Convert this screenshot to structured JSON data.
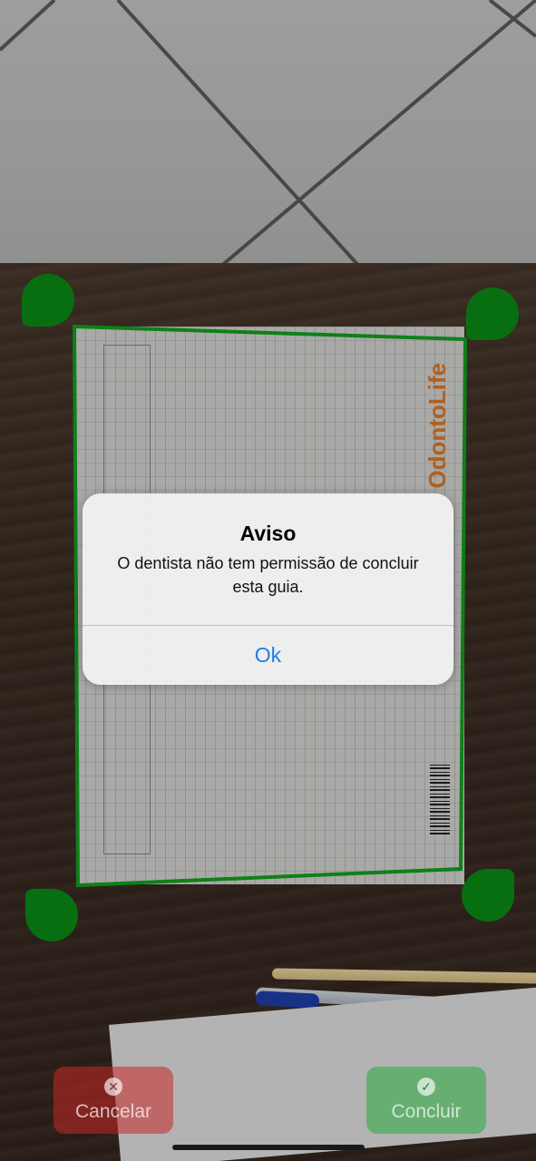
{
  "alert": {
    "title": "Aviso",
    "message": "O dentista não tem permissão de concluir esta guia.",
    "ok_label": "Ok"
  },
  "actions": {
    "cancel_label": "Cancelar",
    "cancel_icon": "close-circle-icon",
    "done_label": "Concluir",
    "done_icon": "checkmark-circle-icon"
  },
  "document": {
    "logo_text": "OdontoLife"
  },
  "colors": {
    "accent_blue": "#1d7fe0",
    "crop_green": "#0b8f16",
    "cancel_red": "#c82828",
    "done_green": "#28aa3c"
  }
}
